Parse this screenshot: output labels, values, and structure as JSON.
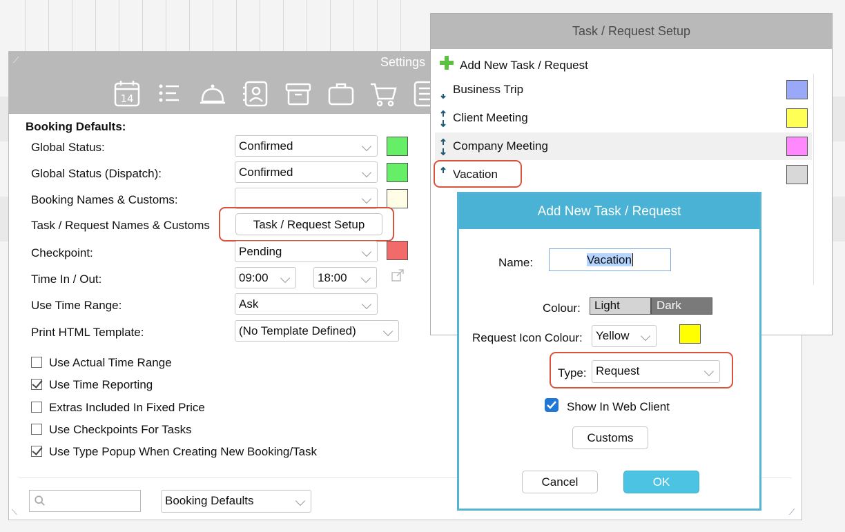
{
  "settings": {
    "title": "Settings",
    "section_label": "Booking Defaults:",
    "rows": {
      "global_status": {
        "label": "Global Status:",
        "value": "Confirmed",
        "color": "#66ee66"
      },
      "global_status_dispatch": {
        "label": "Global Status (Dispatch):",
        "value": "Confirmed",
        "color": "#66ee66"
      },
      "booking_names": {
        "label": "Booking Names & Customs:",
        "value": "",
        "color": "#fffde6"
      },
      "task_request_names": {
        "label": "Task / Request Names & Customs",
        "button": "Task / Request Setup"
      },
      "checkpoint": {
        "label": "Checkpoint:",
        "value": "Pending",
        "color": "#f26b6b"
      },
      "time_in_out": {
        "label": "Time In / Out:",
        "time_in": "09:00",
        "time_out": "18:00"
      },
      "use_time_range": {
        "label": "Use Time Range:",
        "value": "Ask"
      },
      "print_html_template": {
        "label": "Print HTML Template:",
        "value": "(No Template Defined)"
      }
    },
    "checkboxes": [
      {
        "label": "Use Actual Time Range",
        "checked": false
      },
      {
        "label": "Use Time Reporting",
        "checked": true
      },
      {
        "label": "Extras Included In Fixed Price",
        "checked": false
      },
      {
        "label": "Use Checkpoints For Tasks",
        "checked": false
      },
      {
        "label": "Use Type Popup When Creating New Booking/Task",
        "checked": true
      }
    ],
    "footer_select": "Booking Defaults",
    "toolbar_icons": [
      "calendar-icon",
      "list-icon",
      "bell-icon",
      "contacts-icon",
      "archive-icon",
      "briefcase-icon",
      "cart-icon",
      "notes-icon"
    ],
    "calendar_icon_day": "14"
  },
  "task_setup": {
    "title": "Task / Request Setup",
    "add_label": "Add New Task / Request",
    "items": [
      {
        "label": "Business Trip",
        "color": "#99a9f7"
      },
      {
        "label": "Client Meeting",
        "color": "#ffff55"
      },
      {
        "label": "Company Meeting",
        "color": "#ff88ff"
      },
      {
        "label": "Vacation",
        "color": "#d8d8d8"
      }
    ]
  },
  "dialog": {
    "title": "Add New Task / Request",
    "name_label": "Name:",
    "name_value": "Vacation",
    "colour_label": "Colour:",
    "colour_light": "Light",
    "colour_dark": "Dark",
    "icon_colour_label": "Request Icon Colour:",
    "icon_colour_value": "Yellow",
    "icon_colour_swatch": "#ffff00",
    "type_label": "Type:",
    "type_value": "Request",
    "show_web_label": "Show In Web Client",
    "show_web_checked": true,
    "customs_label": "Customs",
    "cancel_label": "Cancel",
    "ok_label": "OK"
  }
}
